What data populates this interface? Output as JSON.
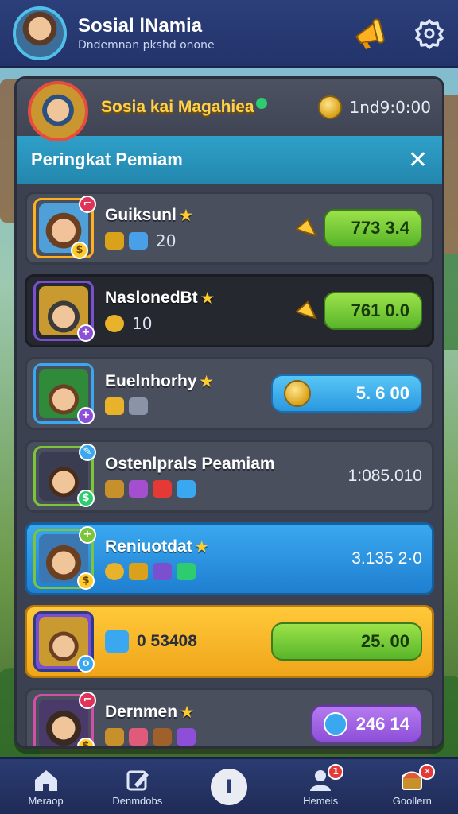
{
  "header": {
    "title": "Sosial lNamia",
    "subtitle": "Dndemnan pkshd onone"
  },
  "panel": {
    "user_name": "Sosia kai Magahiea",
    "timer": "1nd9:0:00",
    "tab_title": "Peringkat Pemiam",
    "close_symbol": "✕"
  },
  "leaderboard": [
    {
      "name": "Guiksunl",
      "level": "20",
      "score": "773 3.4",
      "style": "normal",
      "pill": "green"
    },
    {
      "name": "NaslonedBt",
      "level": "10",
      "score": "761 0.0",
      "style": "dark",
      "pill": "green"
    },
    {
      "name": "Euelnhorhy",
      "level": "",
      "score": "5. 6 00",
      "style": "normal",
      "pill": "blue"
    },
    {
      "name": "Ostenlprals Peamiam",
      "level": "",
      "score": "1:085.010",
      "style": "normal",
      "pill": "none"
    },
    {
      "name": "Reniuotdat",
      "level": "",
      "score": "3.135 2·0",
      "style": "blue",
      "pill": "none"
    },
    {
      "name": "",
      "level": "",
      "score": "25. 00",
      "inline_text": "0 53408",
      "style": "gold",
      "pill": "green"
    },
    {
      "name": "Dernmen",
      "level": "",
      "score": "246 14",
      "style": "normal",
      "pill": "purple"
    }
  ],
  "nav": [
    {
      "label": "Meraop",
      "icon": "home-icon",
      "badge": ""
    },
    {
      "label": "Denmdobs",
      "icon": "edit-icon",
      "badge": ""
    },
    {
      "label": "",
      "icon": "info-icon",
      "badge": "",
      "center_glyph": "I"
    },
    {
      "label": "Hemeis",
      "icon": "person-icon",
      "badge": "1"
    },
    {
      "label": "Goollern",
      "icon": "chest-icon",
      "badge": "✕"
    }
  ],
  "colors": {
    "accent_blue": "#2fa0c9",
    "gold": "#ffd24a",
    "green_pill": "#59b52a",
    "purple_pill": "#8d4fd8"
  }
}
